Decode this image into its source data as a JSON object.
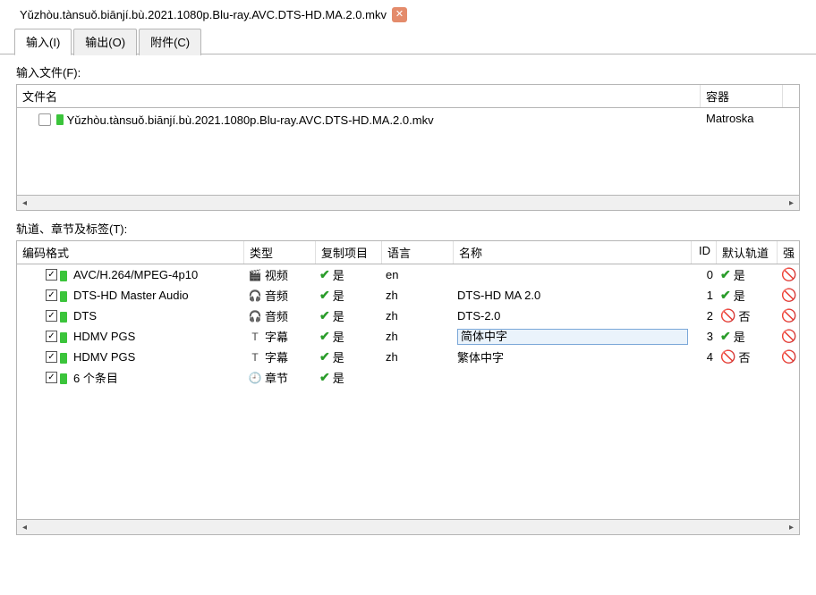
{
  "file_tab": {
    "label": "Yǔzhòu.tànsuǒ.biānjí.bù.2021.1080p.Blu-ray.AVC.DTS-HD.MA.2.0.mkv"
  },
  "tabs": {
    "input": "输入(I)",
    "output": "输出(O)",
    "attach": "附件(C)"
  },
  "section_input_files": "输入文件(F):",
  "file_table": {
    "headers": {
      "name": "文件名",
      "container": "容器"
    },
    "rows": [
      {
        "name": "Yǔzhòu.tànsuǒ.biānjí.bù.2021.1080p.Blu-ray.AVC.DTS-HD.MA.2.0.mkv",
        "container": "Matroska"
      }
    ]
  },
  "section_tracks": "轨道、章节及标签(T):",
  "track_table": {
    "headers": {
      "format": "编码格式",
      "type": "类型",
      "copy": "复制项目",
      "lang": "语言",
      "name": "名称",
      "id": "ID",
      "default": "默认轨道",
      "rest": "强"
    },
    "yes": "是",
    "no": "否",
    "types": {
      "video": "视频",
      "audio": "音频",
      "subtitle": "字幕",
      "chapter": "章节"
    },
    "rows": [
      {
        "checked": true,
        "fmt": "AVC/H.264/MPEG-4p10",
        "type": "video",
        "copy": true,
        "lang": "en",
        "name": "",
        "editing": false,
        "id": 0,
        "def": true
      },
      {
        "checked": true,
        "fmt": "DTS-HD Master Audio",
        "type": "audio",
        "copy": true,
        "lang": "zh",
        "name": "DTS-HD MA 2.0",
        "editing": false,
        "id": 1,
        "def": true
      },
      {
        "checked": true,
        "fmt": "DTS",
        "type": "audio",
        "copy": true,
        "lang": "zh",
        "name": "DTS-2.0",
        "editing": false,
        "id": 2,
        "def": false
      },
      {
        "checked": true,
        "fmt": "HDMV PGS",
        "type": "subtitle",
        "copy": true,
        "lang": "zh",
        "name": "简体中字",
        "editing": true,
        "id": 3,
        "def": true
      },
      {
        "checked": true,
        "fmt": "HDMV PGS",
        "type": "subtitle",
        "copy": true,
        "lang": "zh",
        "name": "繁体中字",
        "editing": false,
        "id": 4,
        "def": false
      },
      {
        "checked": true,
        "fmt": "6 个条目",
        "type": "chapter",
        "copy": true,
        "lang": "",
        "name": "",
        "editing": false,
        "id": "",
        "def": null
      }
    ]
  }
}
